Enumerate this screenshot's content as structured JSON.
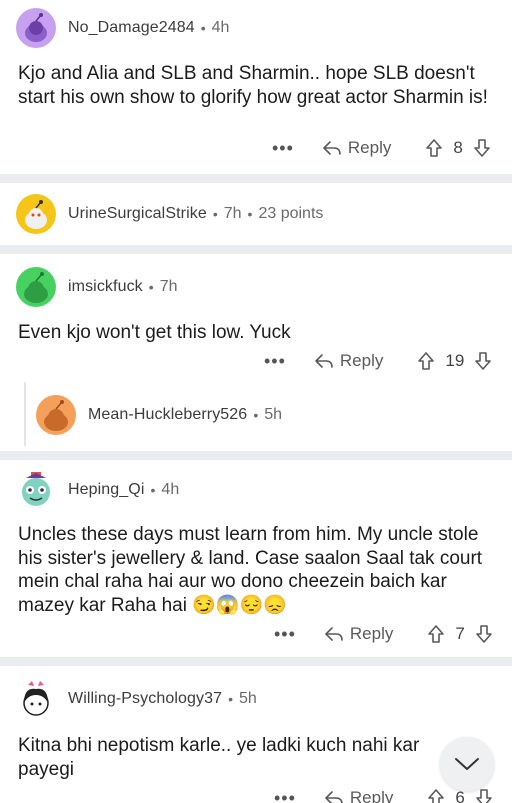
{
  "comments": [
    {
      "username": "No_Damage2484",
      "time": "4h",
      "text": "Kjo and Alia and SLB and Sharmin.. hope SLB doesn't start his own show to glorify how great actor Sharmin is!",
      "reply_label": "Reply",
      "votes": "8",
      "avatar_color": "#c7a0f0"
    },
    {
      "username": "UrineSurgicalStrike",
      "time": "7h",
      "points": "23 points",
      "avatar_color": "#f5c518"
    },
    {
      "username": "imsickfuck",
      "time": "7h",
      "text": "Even kjo won't get this low. Yuck",
      "reply_label": "Reply",
      "votes": "19",
      "avatar_color": "#46d160"
    },
    {
      "username": "Mean-Huckleberry526",
      "time": "5h",
      "avatar_color": "#f5a05a"
    },
    {
      "username": "Heping_Qi",
      "time": "4h",
      "text": "Uncles these days must learn from him. My uncle stole his sister's jewellery & land. Case saalon Saal tak court mein chal raha hai aur wo dono cheezein baich kar mazey kar Raha hai 😏😱😔😞",
      "reply_label": "Reply",
      "votes": "7"
    },
    {
      "username": "Willing-Psychology37",
      "time": "5h",
      "text": "Kitna bhi nepotism karle.. ye ladki kuch nahi kar payegi",
      "reply_label": "Reply",
      "votes": "6"
    }
  ],
  "more_label": "•••",
  "colors": {
    "separator": "#eaedef",
    "snoo_body": "#d7dadc"
  }
}
